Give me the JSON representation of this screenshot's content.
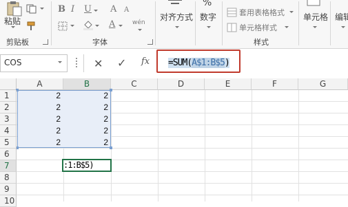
{
  "ribbon": {
    "clipboard": {
      "paste_label": "粘贴",
      "group_label": "剪贴板"
    },
    "font": {
      "bold": "B",
      "italic": "I",
      "underline": "U",
      "grow": "A",
      "shrink": "A",
      "color_letter": "A",
      "phonetic": "wén",
      "group_label": "字体"
    },
    "alignment": {
      "label": "对齐方式"
    },
    "number": {
      "label": "数字"
    },
    "styles": {
      "table_format": "套用表格格式",
      "cell_styles": "单元格样式",
      "group_label": "样式"
    },
    "cells": {
      "label": "单元格"
    },
    "editing": {
      "label": "编辑"
    }
  },
  "formula_bar": {
    "name_box": "COS",
    "cancel_icon": "✕",
    "enter_icon": "✓",
    "fx_label": "fx",
    "formula_prefix": "=SUM(",
    "formula_ref": "A$1:B$5",
    "formula_suffix": ")"
  },
  "sheet": {
    "columns": [
      "A",
      "B",
      "C",
      "D",
      "E",
      "F",
      "G"
    ],
    "rows": [
      "1",
      "2",
      "3",
      "4",
      "5",
      "6",
      "7",
      "8",
      "9",
      "10"
    ],
    "col_a": [
      "2",
      "2",
      "2",
      "2",
      "2"
    ],
    "col_b": [
      "2",
      "2",
      "2",
      "2",
      "2"
    ],
    "edit_cell_text": ":1:B$5)"
  },
  "colors": {
    "accent_green": "#217346",
    "highlight_red": "#c0392b",
    "selection_blue": "#7a9fd0"
  }
}
